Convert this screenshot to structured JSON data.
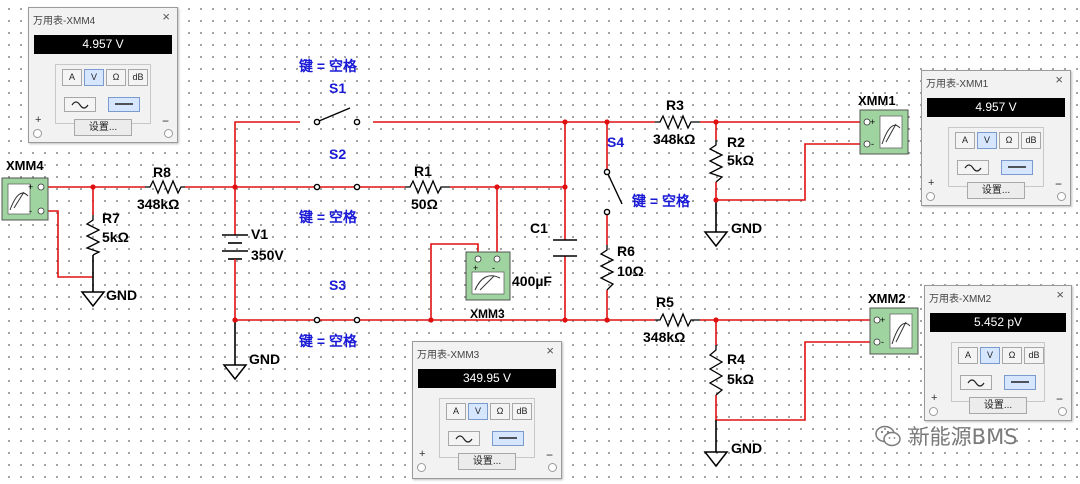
{
  "labels": {
    "xmm4_label": "XMM4",
    "xmm1_label": "XMM1",
    "xmm2_label": "XMM2",
    "xmm3_label": "XMM3",
    "r8": "R8",
    "r8_val": "348kΩ",
    "r7": "R7",
    "r7_val": "5kΩ",
    "r1": "R1",
    "r1_val": "50Ω",
    "r3": "R3",
    "r3_val": "348kΩ",
    "r2": "R2",
    "r2_val": "5kΩ",
    "r6": "R6",
    "r6_val": "10Ω",
    "r5": "R5",
    "r5_val": "348kΩ",
    "r4": "R4",
    "r4_val": "5kΩ",
    "v1": "V1",
    "v1_val": "350V",
    "c1": "C1",
    "c1_val": "400µF",
    "s1": "S1",
    "s2": "S2",
    "s3": "S3",
    "s4": "S4",
    "key_s1": "键 = 空格",
    "key_s2": "键 = 空格",
    "key_s3": "键 = 空格",
    "key_s4": "键 = 空格",
    "gnd": "GND"
  },
  "multimeters": {
    "xmm4": {
      "title": "万用表-XMM4",
      "reading": "4.957 V"
    },
    "xmm1": {
      "title": "万用表-XMM1",
      "reading": "4.957 V"
    },
    "xmm2": {
      "title": "万用表-XMM2",
      "reading": "5.452 pV"
    },
    "xmm3": {
      "title": "万用表-XMM3",
      "reading": "349.95 V"
    }
  },
  "meter_controls": {
    "amp": "A",
    "volt": "V",
    "ohm": "Ω",
    "db": "dB",
    "settings": "设置...",
    "plus": "+",
    "minus": "−",
    "close": "×",
    "selected_mode": "V",
    "selected_wave": "dc"
  },
  "watermark": {
    "text": "新能源BMS",
    "icon": "wechat-icon"
  },
  "colors": {
    "wire_red": "#e01010",
    "wire_black": "#000000",
    "switch_label": "#1a1ad6",
    "meter_body": "#9fd4a0"
  }
}
